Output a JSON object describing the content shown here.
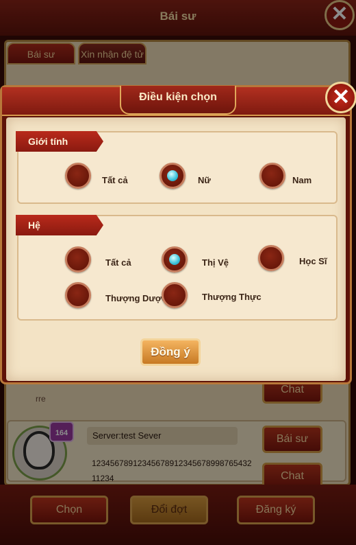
{
  "background": {
    "title": "Bái sư",
    "tabs": [
      "Bái sư",
      "Xin nhận đệ tử"
    ],
    "card1": {
      "name": "rre",
      "chat_label": "Chat"
    },
    "card2": {
      "level": "164",
      "server": "Server:test Sever",
      "description": "12345678912345678912345678998765432 11234",
      "bai_su_label": "Bái sư",
      "chat_label": "Chat"
    },
    "bottom_buttons": [
      "Chọn",
      "Đổi đợt",
      "Đăng ký"
    ]
  },
  "dialog": {
    "title": "Điều kiện chọn",
    "gender": {
      "label": "Giới tính",
      "options": [
        "Tất cả",
        "Nữ",
        "Nam"
      ],
      "selected": "Nữ"
    },
    "he": {
      "label": "Hệ",
      "options": [
        "Tất cả",
        "Thị Vệ",
        "Học Sĩ",
        "Thượng Dược",
        "Thượng Thực"
      ],
      "selected": "Thị Vệ"
    },
    "agree_label": "Đồng ý"
  },
  "colors": {
    "accent_red": "#b92a1b",
    "selected_dot": "#39c0d8",
    "agree_button": "#f4b460"
  }
}
